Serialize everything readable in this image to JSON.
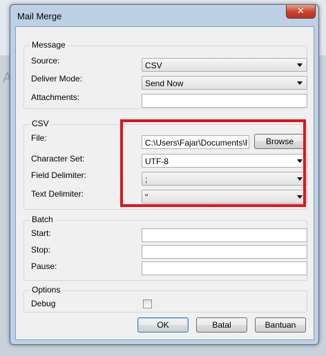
{
  "window": {
    "title": "Mail Merge",
    "close_glyph": "✕"
  },
  "background": {
    "letter": "A"
  },
  "message": {
    "legend": "Message",
    "source_label": "Source:",
    "source_value": "CSV",
    "deliver_label": "Deliver Mode:",
    "deliver_value": "Send Now",
    "attachments_label": "Attachments:",
    "attachments_value": ""
  },
  "csv": {
    "legend": "CSV",
    "file_label": "File:",
    "file_value": "C:\\Users\\Fajar\\Documents\\F",
    "browse_label": "Browse",
    "charset_label": "Character Set:",
    "charset_value": "UTF-8",
    "field_delim_label": "Field Delimiter:",
    "field_delim_value": ";",
    "text_delim_label": "Text Delimiter:",
    "text_delim_value": "\""
  },
  "batch": {
    "legend": "Batch",
    "start_label": "Start:",
    "stop_label": "Stop:",
    "pause_label": "Pause:",
    "start_value": "",
    "stop_value": "",
    "pause_value": ""
  },
  "options": {
    "legend": "Options",
    "debug_label": "Debug",
    "debug_checked": false
  },
  "buttons": {
    "ok": "OK",
    "cancel": "Batal",
    "help": "Bantuan"
  },
  "colors": {
    "highlight": "#e0141e",
    "default_button_border": "#3c7fb1"
  }
}
